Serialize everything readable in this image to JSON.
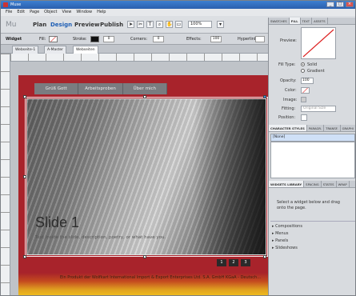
{
  "window": {
    "title": "Muse",
    "minimize": "_",
    "maximize": "□",
    "close": "×"
  },
  "menu": [
    "File",
    "Edit",
    "Page",
    "Object",
    "View",
    "Window",
    "Help"
  ],
  "modes": {
    "logo": "Mu",
    "plan": "Plan",
    "design": "Design",
    "preview": "Preview",
    "publish": "Publish",
    "active": "Design"
  },
  "toolbar": {
    "zoom": "100%"
  },
  "properties": {
    "widget": "Widget",
    "fill": "Fill:",
    "stroke": "Stroke:",
    "stroke_value": "0",
    "corners": "Corners:",
    "corners_value": "0",
    "effects": "Effects:",
    "effects_value": "100",
    "hyperlink": "Hyperlink:"
  },
  "doc_tabs": [
    "Webseite-1",
    "A-Master",
    "Webseiten"
  ],
  "site_nav": [
    "Grüß Gott",
    "Arbeitsproben",
    "Über mich"
  ],
  "slide": {
    "title": "Slide 1",
    "subtitle": "Text inside the slide, description, poetry, or what have you.",
    "pager": [
      "1",
      "2",
      "3"
    ]
  },
  "footer": {
    "text": "Ein Produkt der Wolfkart International Import & Export Enterprises Ltd. S.A. GmbH KGaA - Deutsch..."
  },
  "panel": {
    "top_tabs": [
      "SWATCHES",
      "FILL",
      "TEXT",
      "ASSETS"
    ],
    "active_top_tab": "FILL",
    "preview_label": "Preview:",
    "fill_type_label": "Fill Type:",
    "fill_solid": "Solid",
    "fill_gradient": "Gradient",
    "opacity_label": "Opacity:",
    "opacity_value": "100",
    "color_label": "Color:",
    "image_label": "Image:",
    "fitting_label": "Fitting:",
    "fitting_value": "Original Size",
    "position_label": "Position:",
    "styles_tabs": [
      "CHARACTER STYLES",
      "PARAGR.",
      "TRANSF.",
      "GRAPHI"
    ],
    "styles_selected": "[None]",
    "widget_tabs": [
      "WIDGETS LIBRARY",
      "SPACING",
      "STATES",
      "WRAP"
    ],
    "widget_hint": "Select a widget below and drag onto the page.",
    "categories": [
      "Compositions",
      "Menus",
      "Panels",
      "Slideshows"
    ]
  },
  "colors": {
    "page_red": "#a8232b",
    "accent_blue": "#1f5fb5",
    "panel_bg": "#d8dbdf"
  }
}
